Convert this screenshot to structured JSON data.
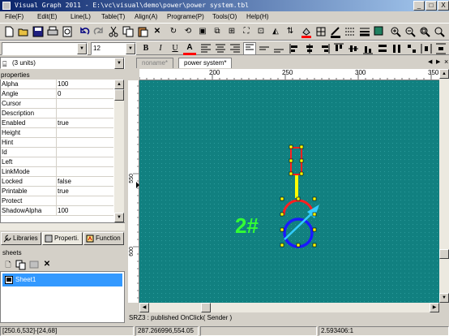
{
  "window": {
    "title": "Visual Graph 2011 - E:\\vc\\visual\\demo\\power\\power system.tbl",
    "minimize_label": "_",
    "maximize_label": "□",
    "close_label": "X"
  },
  "menu": [
    {
      "label": "File(F)"
    },
    {
      "label": "Edit(E)"
    },
    {
      "label": "Line(L)"
    },
    {
      "label": "Table(T)"
    },
    {
      "label": "Align(A)"
    },
    {
      "label": "Programe(P)"
    },
    {
      "label": "Tools(O)"
    },
    {
      "label": "Help(H)"
    }
  ],
  "format_toolbar": {
    "font_name": "",
    "font_size": "12",
    "bold": "B",
    "italic": "I",
    "underline": "U",
    "font_color": "A"
  },
  "object_selector": {
    "value": "(3 units)"
  },
  "properties": {
    "header": "properties",
    "rows": [
      {
        "key": "Alpha",
        "value": "100"
      },
      {
        "key": "Angle",
        "value": "0"
      },
      {
        "key": "Cursor",
        "value": ""
      },
      {
        "key": "Description",
        "value": ""
      },
      {
        "key": "Enabled",
        "value": "true"
      },
      {
        "key": "Height",
        "value": ""
      },
      {
        "key": "Hint",
        "value": ""
      },
      {
        "key": "Id",
        "value": ""
      },
      {
        "key": "Left",
        "value": ""
      },
      {
        "key": "LinkMode",
        "value": ""
      },
      {
        "key": "Locked",
        "value": "false"
      },
      {
        "key": "Printable",
        "value": "true"
      },
      {
        "key": "Protect",
        "value": ""
      },
      {
        "key": "ShadowAlpha",
        "value": "100"
      }
    ]
  },
  "panel_tabs": [
    {
      "label": "Libraries"
    },
    {
      "label": "Properti."
    },
    {
      "label": "Function"
    }
  ],
  "sheets": {
    "header": "sheets",
    "items": [
      {
        "label": "Sheet1"
      }
    ]
  },
  "doc_tabs": [
    {
      "label": "noname*"
    },
    {
      "label": "power system*"
    }
  ],
  "ruler": {
    "top_ticks": [
      "200",
      "250",
      "300",
      "350"
    ],
    "left_ticks": [
      "550",
      "600"
    ]
  },
  "canvas": {
    "label": "2#",
    "colors": {
      "background": "#118080",
      "label": "#33ff33",
      "breaker": "#ff2020",
      "link": "#ffff00",
      "coil_red": "#ff2020",
      "coil_blue": "#1a1aff",
      "arrow": "#33ccff"
    }
  },
  "status_message": "SRZ3 : published OnClick( Sender )",
  "statusbar": {
    "range": "[250.6,532]-[24,68]",
    "coords": "287.266996,554.05",
    "empty": "",
    "scale": "2.593406:1"
  }
}
